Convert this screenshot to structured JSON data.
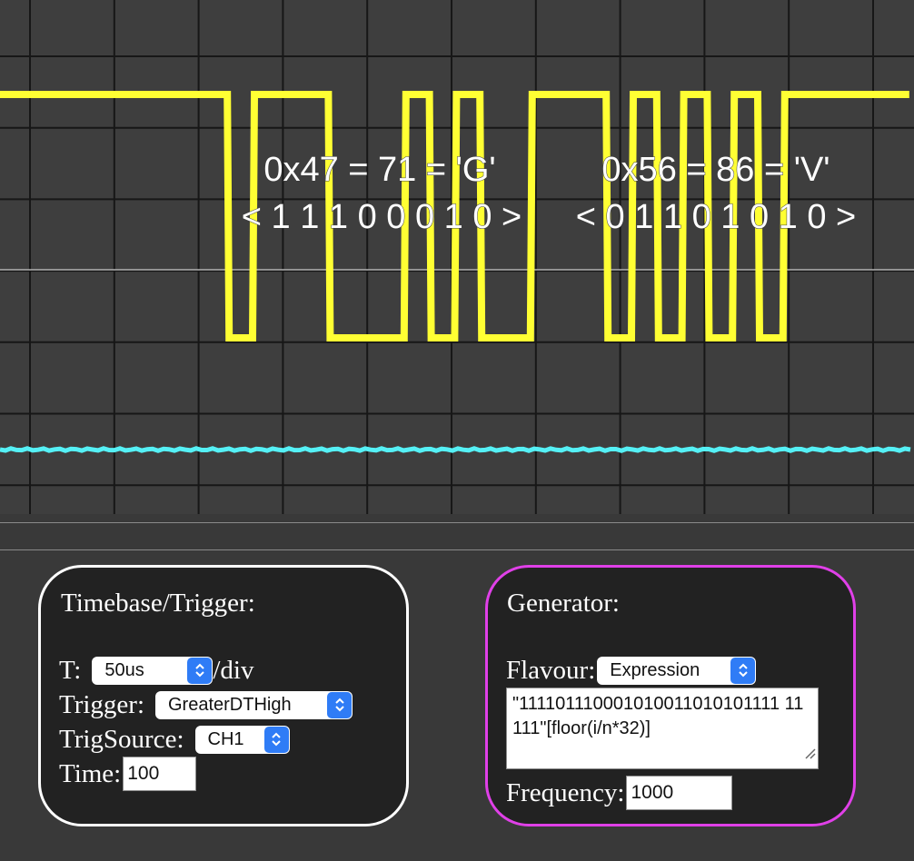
{
  "scope": {
    "colors": {
      "background": "#3e3e3e",
      "grid": "#171717",
      "center_line": "#b4b4b4",
      "channel1": "#ffff33",
      "channel2": "#55f0f5"
    },
    "annotations": [
      {
        "hex": "0x47 = 71 = 'G'",
        "bits": "< 1 1 1  0 0 0  1 0 >"
      },
      {
        "hex": "0x56 = 86 = 'V'",
        "bits": "< 0 1 1  0 1 0 1 0 >"
      }
    ],
    "ch1_levels": "111111111011100010100111010101011111",
    "ch2_level": "low"
  },
  "timebase": {
    "title": "Timebase/Trigger:",
    "border_color": "#ffffff",
    "t_label": "T:",
    "t_value": "50us",
    "t_suffix": "/div",
    "trigger_label": "Trigger:",
    "trigger_value": "GreaterDTHigh",
    "trigsource_label": "TrigSource:",
    "trigsource_value": "CH1",
    "time_label": "Time:",
    "time_value": "100"
  },
  "generator": {
    "title": "Generator:",
    "border_color": "#e040e8",
    "flavour_label": "Flavour:",
    "flavour_value": "Expression",
    "expression": "\"111101110001010011010101111 11111\"[floor(i/n*32)]",
    "frequency_label": "Frequency:",
    "frequency_value": "1000"
  }
}
